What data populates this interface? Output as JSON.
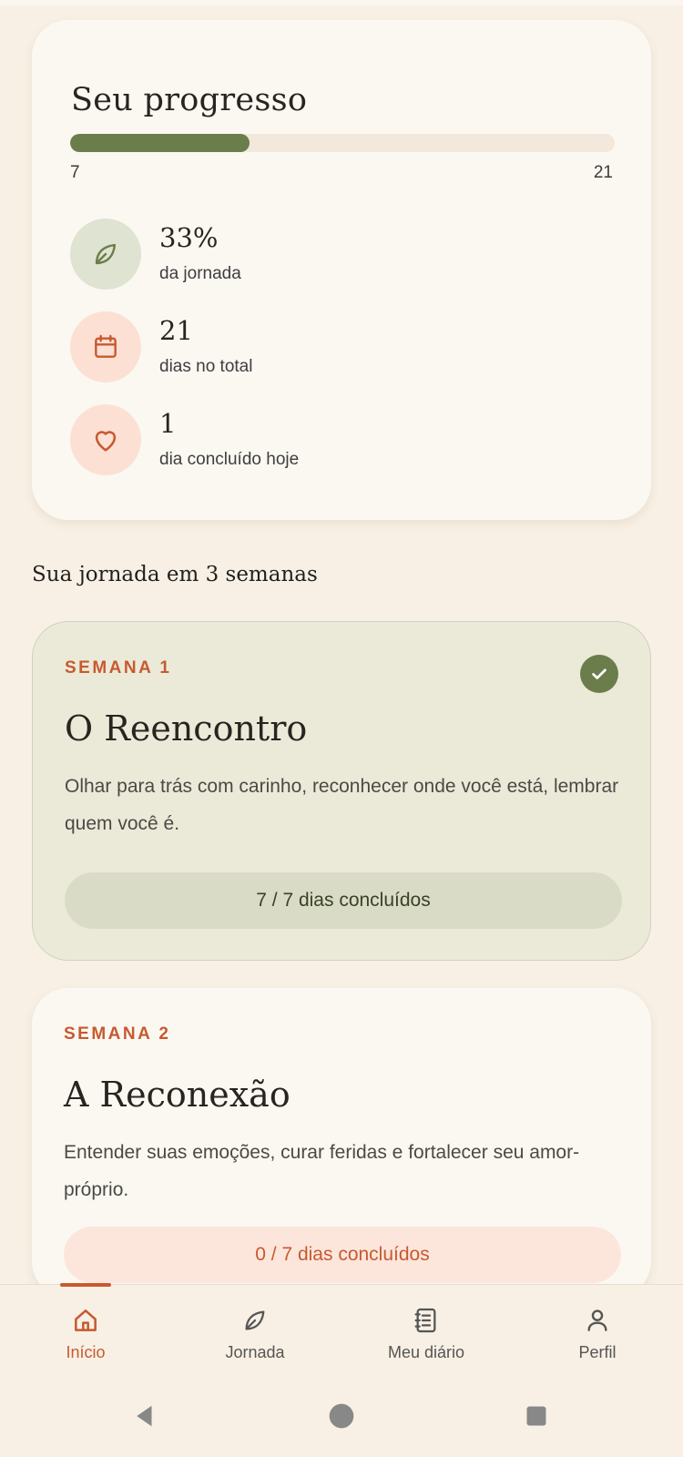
{
  "progress": {
    "title": "Seu progresso",
    "current_day": 7,
    "total_days": 21,
    "fill_fraction": 0.33,
    "bar_min_label": "7",
    "bar_max_label": "21",
    "stats": [
      {
        "icon": "leaf-icon",
        "value": "33%",
        "label": "da jornada"
      },
      {
        "icon": "calendar-icon",
        "value": "21",
        "label": "dias no total"
      },
      {
        "icon": "heart-icon",
        "value": "1",
        "label": "dia concluído hoje"
      }
    ]
  },
  "journey": {
    "heading": "Sua jornada em 3 semanas",
    "weeks": [
      {
        "tag": "SEMANA 1",
        "title": "O Reencontro",
        "description": "Olhar para trás com carinho, reconhecer onde você está, lembrar quem você é.",
        "status": "7 / 7 dias concluídos",
        "completed": true
      },
      {
        "tag": "SEMANA 2",
        "title": "A Reconexão",
        "description": "Entender suas emoções, curar feridas e fortalecer seu amor-próprio.",
        "status": "0 / 7 dias concluídos",
        "completed": false
      }
    ]
  },
  "nav": {
    "items": [
      {
        "label": "Início",
        "icon": "home-icon",
        "active": true
      },
      {
        "label": "Jornada",
        "icon": "leaf-icon",
        "active": false
      },
      {
        "label": "Meu diário",
        "icon": "journal-icon",
        "active": false
      },
      {
        "label": "Perfil",
        "icon": "person-icon",
        "active": false
      }
    ]
  },
  "colors": {
    "accent": "#c8592f",
    "primary_green": "#6b7d4a",
    "background": "#f8f0e4",
    "card": "#fbf8f2"
  }
}
